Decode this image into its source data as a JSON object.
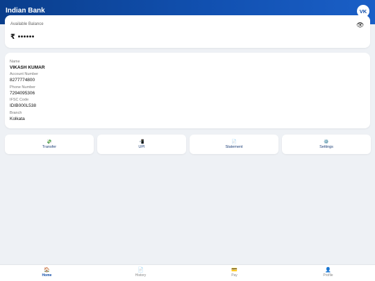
{
  "header": {
    "title": "Indian Bank",
    "avatar_initials": "VK"
  },
  "balance": {
    "label": "Available Balance",
    "value": "₹ ••••••",
    "toggle_icon": "eye-icon"
  },
  "account": {
    "fields": [
      {
        "label": "Name",
        "value": "VIKASH KUMAR"
      },
      {
        "label": "Account Number",
        "value": "8277774800"
      },
      {
        "label": "Phone Number",
        "value": "7294095306"
      },
      {
        "label": "IFSC Code",
        "value": "IDIB000L538"
      },
      {
        "label": "Branch",
        "value": "Kolkata"
      }
    ]
  },
  "actions": [
    {
      "icon": "💸",
      "icon_name": "transfer-icon",
      "label": "Transfer"
    },
    {
      "icon": "📲",
      "icon_name": "upi-icon",
      "label": "UPI"
    },
    {
      "icon": "📄",
      "icon_name": "statement-icon",
      "label": "Statement"
    },
    {
      "icon": "⚙️",
      "icon_name": "settings-icon",
      "label": "Settings"
    }
  ],
  "nav": [
    {
      "icon": "🏠",
      "icon_name": "home-icon",
      "label": "Home",
      "active": true
    },
    {
      "icon": "📄",
      "icon_name": "history-icon",
      "label": "History",
      "active": false
    },
    {
      "icon": "💳",
      "icon_name": "pay-icon",
      "label": "Pay",
      "active": false
    },
    {
      "icon": "👤",
      "icon_name": "profile-icon",
      "label": "Profile",
      "active": false
    }
  ],
  "colors": {
    "primary": "#0d4aa6",
    "background": "#eef1f5",
    "card": "#ffffff"
  }
}
